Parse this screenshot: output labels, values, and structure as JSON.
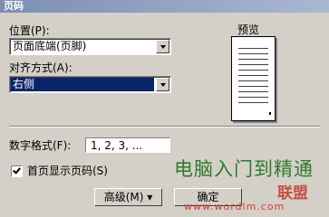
{
  "dialog": {
    "title": "页码"
  },
  "position": {
    "label": "位置(P):",
    "value": "页面底端(页脚)"
  },
  "alignment": {
    "label": "对齐方式(A):",
    "value": "右侧"
  },
  "preview": {
    "label": "预览"
  },
  "number_format": {
    "label": "数字格式(F):",
    "value": "1, 2, 3, ..."
  },
  "first_page": {
    "label": "首页显示页码(S)",
    "checked": true
  },
  "buttons": {
    "advanced": "高级(M) ▾",
    "ok": "确定"
  },
  "watermark": {
    "text": "电脑入门到精通",
    "brand": "联盟",
    "url": "www.wordlm.com"
  }
}
